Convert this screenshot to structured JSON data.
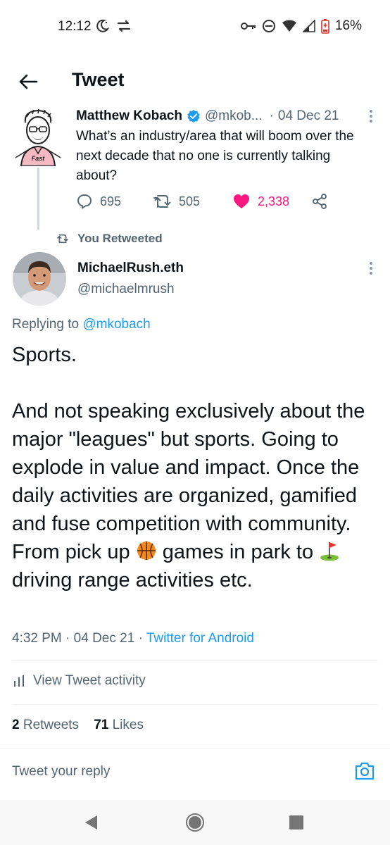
{
  "status_bar": {
    "time": "12:12",
    "battery": "16%"
  },
  "header": {
    "title": "Tweet",
    "back_icon": "arrow-left-icon"
  },
  "original_tweet": {
    "author_name": "Matthew Kobach",
    "handle": "@mkob...",
    "separator": "·",
    "date": "04 Dec 21",
    "text": "What’s an industry/area that will boom over the next decade that no one is currently talking about?",
    "avatar_caption": "Fast",
    "replies": "695",
    "retweets": "505",
    "likes": "2,338"
  },
  "retweet_label": "You Retweeted",
  "main_tweet": {
    "author_name": "MichaelRush.eth",
    "handle": "@michaelmrush",
    "replying_prefix": "Replying to",
    "replying_to": "@mkobach",
    "text_part1": "Sports.\n\nAnd not speaking exclusively about the major \"leagues\" but sports. Going to explode in value and impact. Once the daily activities are organized, gamified and fuse competition with community. From pick up ",
    "text_part2": " games in park to ",
    "text_part3": " driving range activities etc.",
    "time": "4:32 PM",
    "meta_sep": "·",
    "date": "04 Dec 21",
    "source": "Twitter for Android",
    "activity_label": "View Tweet activity",
    "retweets_count": "2",
    "retweets_label": "Retweets",
    "likes_count": "71",
    "likes_label": "Likes"
  },
  "reply": {
    "placeholder": "Tweet your reply"
  },
  "colors": {
    "accent": "#1d9bf0",
    "like": "#f91880",
    "secondary_text": "#536471"
  }
}
